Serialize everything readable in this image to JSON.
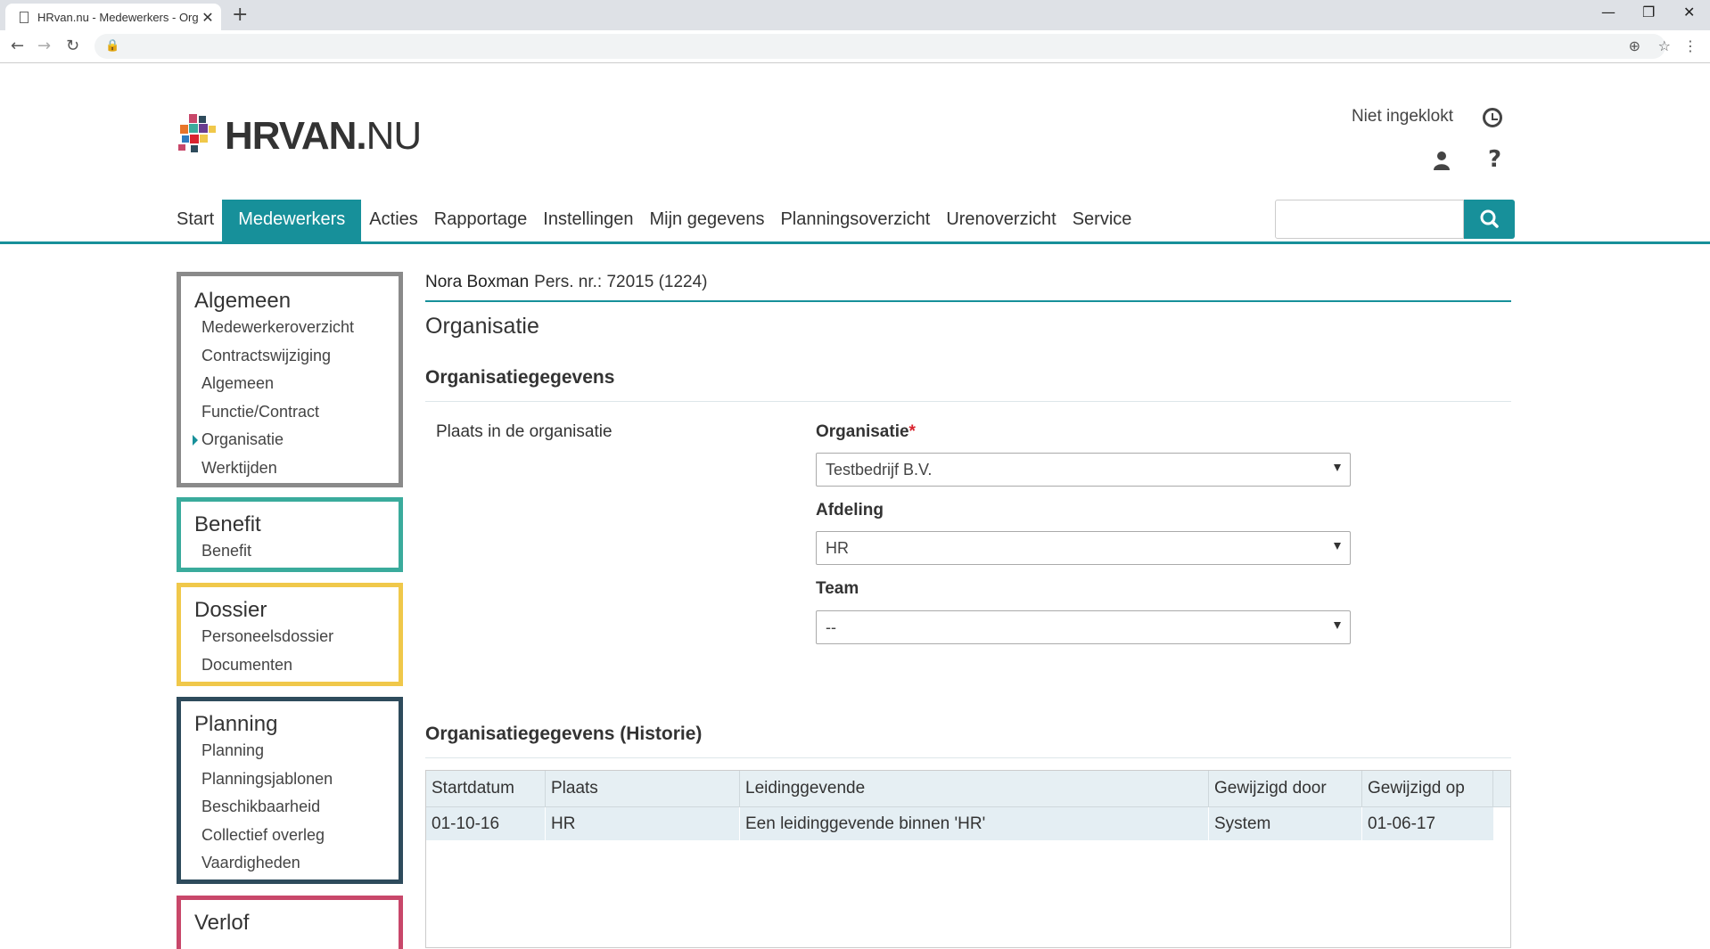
{
  "browser": {
    "tab_title": "HRvan.nu - Medewerkers - Organisatie",
    "new_tab": "+",
    "close": "✕",
    "minimize": "—",
    "restore": "❐",
    "window_close": "✕"
  },
  "header": {
    "logo_bold": "HRVAN.",
    "logo_light": "NU",
    "clock_status": "Niet ingeklokt",
    "help": "?"
  },
  "nav": {
    "items": [
      "Start",
      "Medewerkers",
      "Acties",
      "Rapportage",
      "Instellingen",
      "Mijn gegevens",
      "Planningsoverzicht",
      "Urenoverzicht",
      "Service"
    ],
    "active": "Medewerkers",
    "search_value": ""
  },
  "sidebar": {
    "algemeen": {
      "title": "Algemeen",
      "color": "#8a8a8a",
      "items": [
        "Medewerkeroverzicht",
        "Contractswijziging",
        "Algemeen",
        "Functie/Contract",
        "Organisatie",
        "Werktijden"
      ]
    },
    "benefit": {
      "title": "Benefit",
      "color": "#3aab9c",
      "items": [
        "Benefit"
      ]
    },
    "dossier": {
      "title": "Dossier",
      "color": "#f0c84a",
      "items": [
        "Personeelsdossier",
        "Documenten"
      ]
    },
    "planning": {
      "title": "Planning",
      "color": "#2e4b5c",
      "items": [
        "Planning",
        "Planningsjablonen",
        "Beschikbaarheid",
        "Collectief overleg",
        "Vaardigheden"
      ]
    },
    "verlof": {
      "title": "Verlof",
      "color": "#c8476a"
    }
  },
  "employee": {
    "name": "Nora Boxman",
    "pers_nr": "Pers. nr.: 72015 (1224)"
  },
  "page": {
    "title": "Organisatie",
    "section1": "Organisatiegegevens",
    "field_group_label": "Plaats in de organisatie",
    "organisatie_label": "Organisatie",
    "required_mark": "*",
    "organisatie_value": "Testbedrijf B.V.",
    "afdeling_label": "Afdeling",
    "afdeling_value": "HR",
    "team_label": "Team",
    "team_value": "--",
    "section2": "Organisatiegegevens (Historie)"
  },
  "history": {
    "columns": [
      "Startdatum",
      "Plaats",
      "Leidinggevende",
      "Gewijzigd door",
      "Gewijzigd op"
    ],
    "rows": [
      [
        "01-10-16",
        "HR",
        "Een leidinggevende binnen 'HR'",
        "System",
        "01-06-17"
      ]
    ]
  }
}
